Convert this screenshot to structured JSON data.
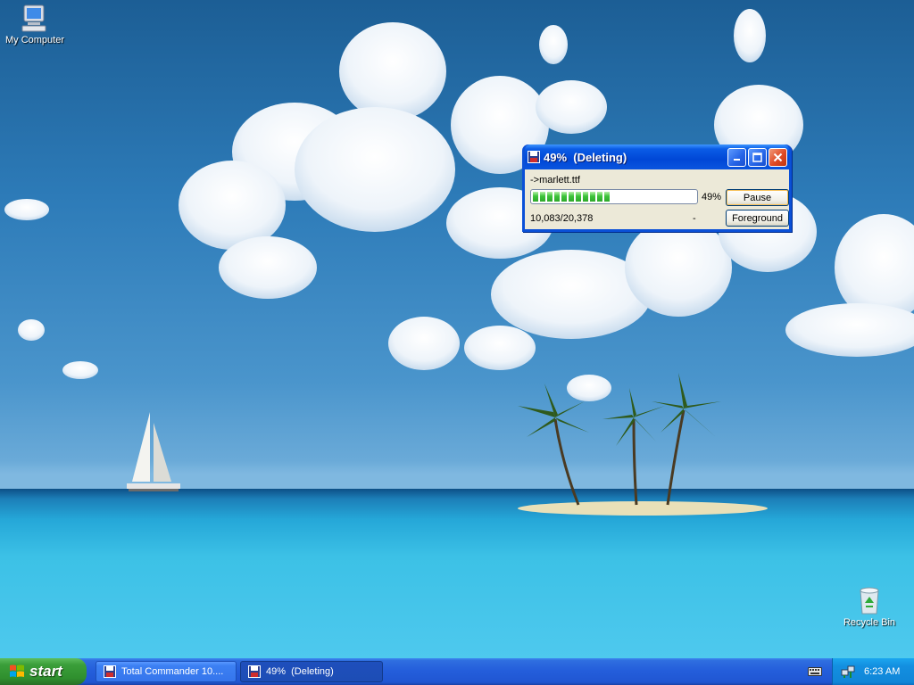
{
  "desktop": {
    "icons": [
      {
        "label": "My Computer",
        "icon": "my-computer-icon"
      },
      {
        "label": "Recycle Bin",
        "icon": "recycle-bin-icon"
      }
    ]
  },
  "dialog": {
    "title": "49%  (Deleting)",
    "file": "->marlett.ttf",
    "progress_percent": 49,
    "percent_label": "49%",
    "count": "10,083/20,378",
    "dash": "-",
    "buttons": {
      "pause": "Pause",
      "foreground": "Foreground"
    },
    "title_icon": "floppy-disk-icon"
  },
  "taskbar": {
    "start_label": "start",
    "tasks": [
      {
        "label": "Total Commander 10....",
        "icon": "total-commander-icon",
        "active": false
      },
      {
        "label": "49%  (Deleting)",
        "icon": "floppy-disk-icon",
        "active": true
      }
    ],
    "clock": "6:23 AM",
    "tray_icons": [
      "keyboard-icon",
      "network-icon"
    ]
  },
  "colors": {
    "taskbar_blue": "#245edb",
    "start_green": "#3a9e39",
    "dialog_face": "#ece9d8",
    "progress_green": "#3dc33a"
  }
}
